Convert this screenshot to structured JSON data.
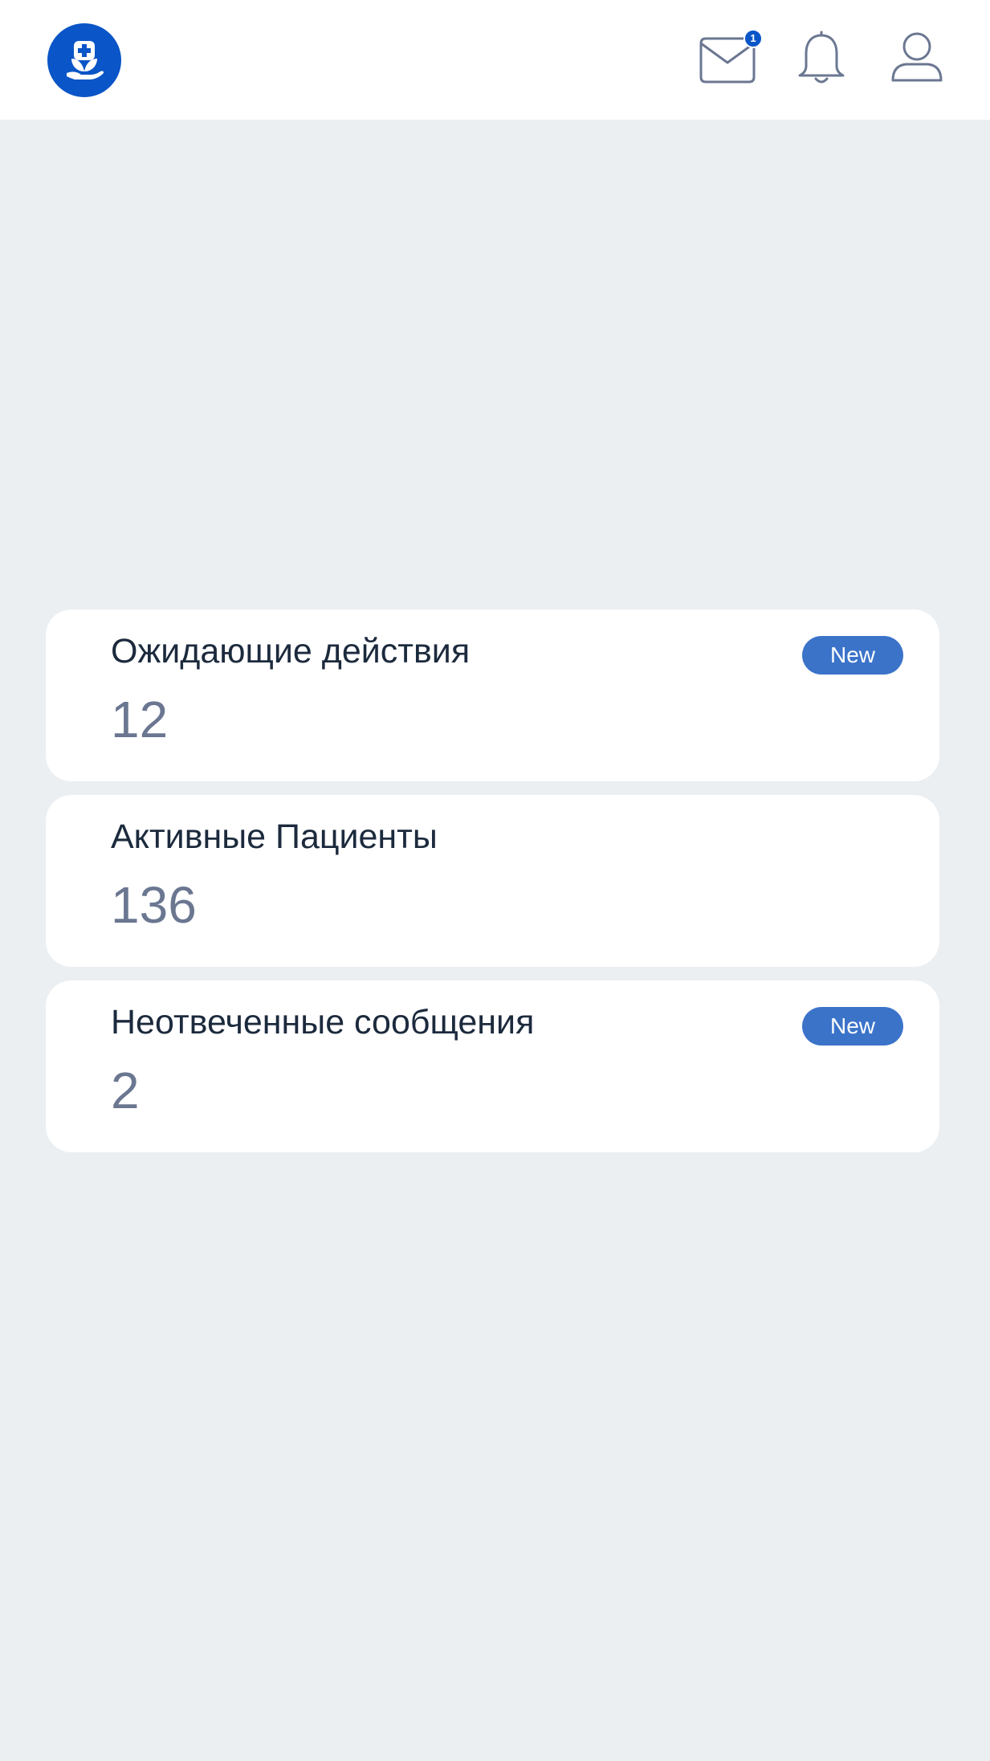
{
  "header": {
    "logo_icon": "medical-hands-logo-icon",
    "icons": [
      "mail-icon",
      "bell-icon",
      "user-icon"
    ],
    "mail_unread_count": "1",
    "accent_color": "#0a55c7"
  },
  "cards": [
    {
      "title": "Ожидающие действия",
      "value": "12",
      "badge": "New"
    },
    {
      "title": "Активные Пациенты",
      "value": "136"
    },
    {
      "title": "Неотвеченные сообщения",
      "value": "2",
      "badge": "New"
    }
  ],
  "colors": {
    "background": "#ebeff2",
    "card": "#ffffff",
    "title_text": "#1c2a3d",
    "value_text": "#6b7791",
    "badge": "#3b73c9",
    "icon_stroke": "#6b7791"
  }
}
